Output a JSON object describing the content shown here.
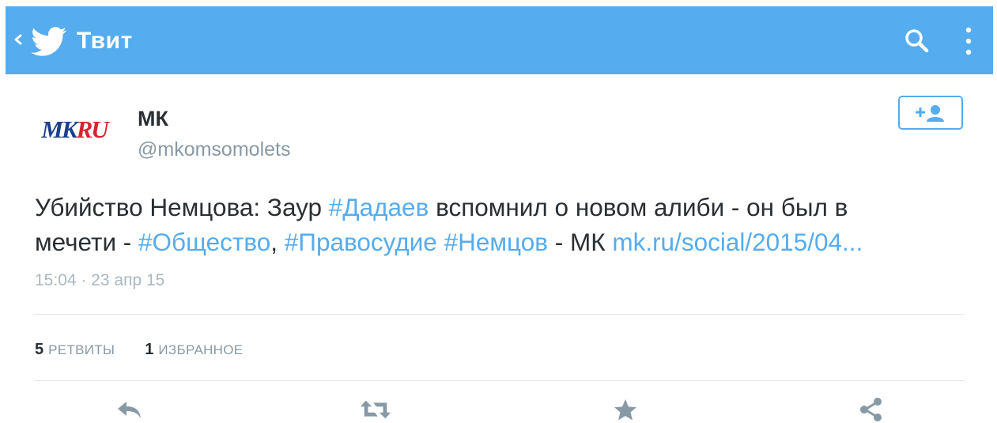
{
  "appbar": {
    "title": "Твит",
    "background_color": "#55acee",
    "icons": [
      "back-arrow-icon",
      "twitter-bird-icon",
      "search-icon",
      "overflow-menu-icon"
    ]
  },
  "tweet": {
    "avatar_text_blue": "MK",
    "avatar_text_red": "RU",
    "user_name": "МК",
    "user_handle": "@mkomsomolets",
    "text_line1": {
      "part1": "Убийство Немцова: Заур ",
      "hashtag1": "#Дадаев",
      "part2": " вспомнил о новом алиби - он был в"
    },
    "text_line2": {
      "part1": "мечети - ",
      "hashtag2": "#Общество",
      "part2": ", ",
      "hashtag3": "#Правосудие",
      "part3": " ",
      "hashtag4": "#Немцов",
      "part4": " - МК ",
      "link": "mk.ru/social/2015/04..."
    },
    "timestamp": "15:04 · 23 апр 15",
    "link_color": "#55acee"
  },
  "stats": {
    "retweets_count": "5",
    "retweets_label": "РЕТВИТЫ",
    "favorites_count": "1",
    "favorites_label": "ИЗБРАННОЕ"
  },
  "actions": [
    "reply-icon",
    "retweet-icon",
    "favorite-star-icon",
    "share-icon"
  ]
}
